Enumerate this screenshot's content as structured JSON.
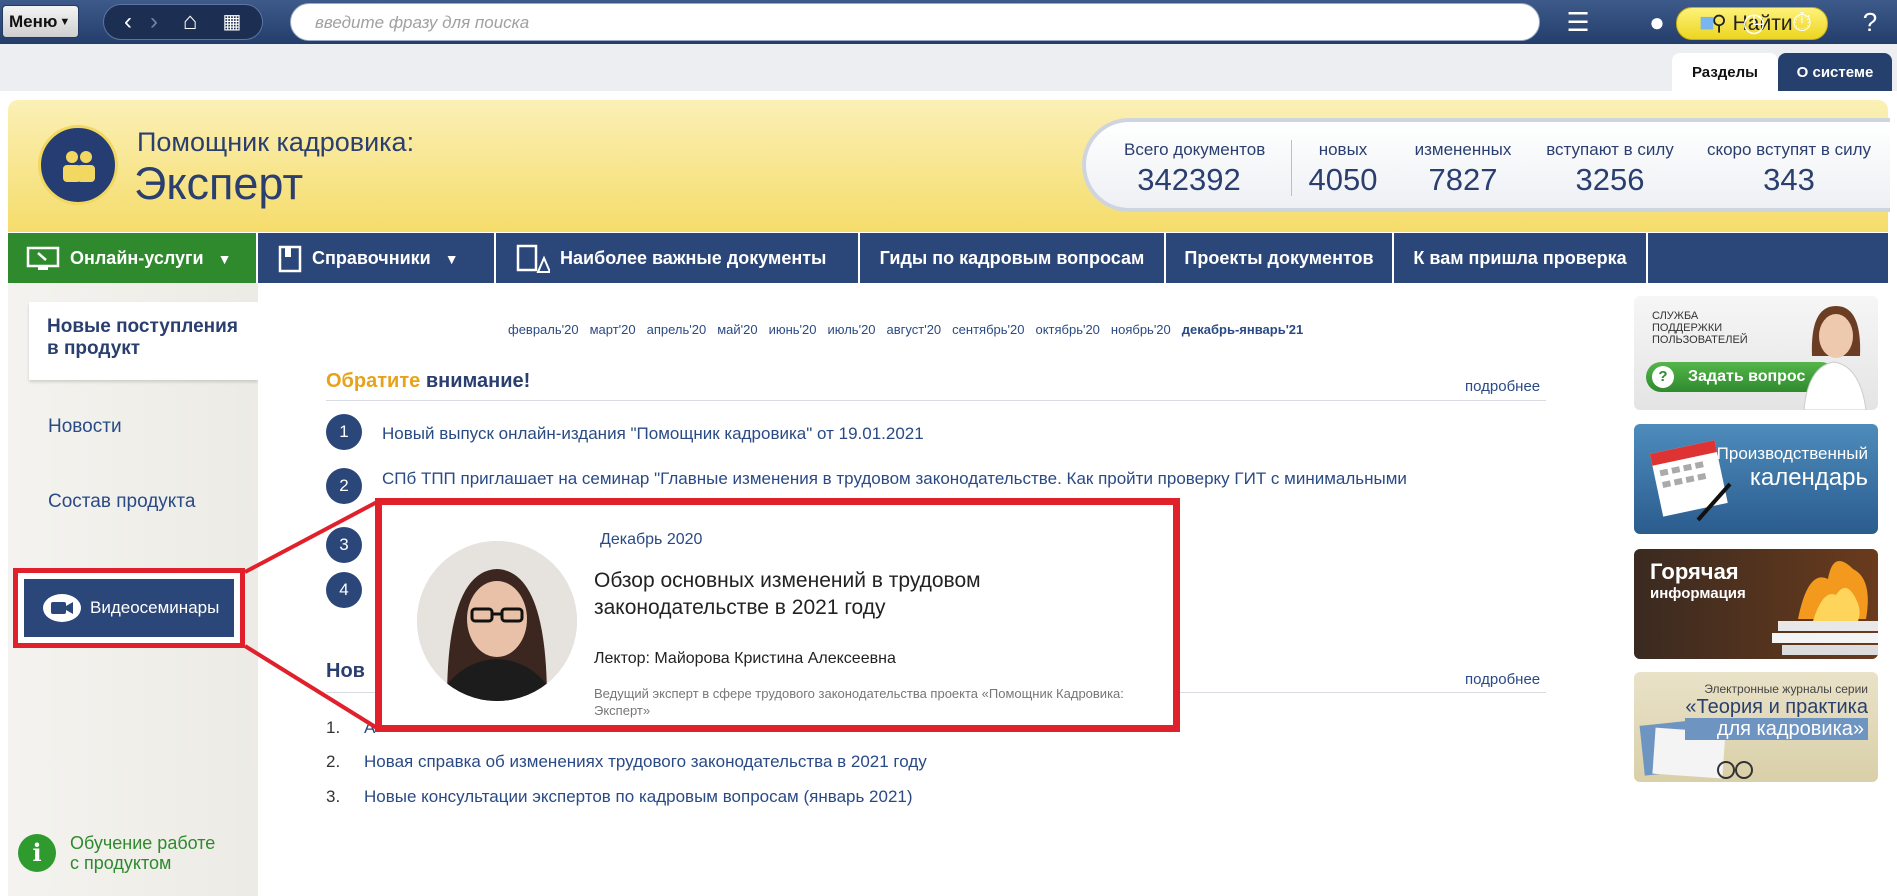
{
  "topbar": {
    "menu_label": "Меню",
    "search_placeholder": "введите фразу для поиска",
    "find_label": "Найти"
  },
  "tabs": [
    {
      "label": "Разделы",
      "active": true
    },
    {
      "label": "О системе",
      "active": false
    }
  ],
  "brand": {
    "line1": "Помощник кадровика:",
    "line2": "Эксперт"
  },
  "stats": [
    {
      "label": "Всего документов",
      "value": "342392"
    },
    {
      "label": "новых",
      "value": "4050"
    },
    {
      "label": "измененных",
      "value": "7827"
    },
    {
      "label": "вступают в силу",
      "value": "3256"
    },
    {
      "label": "скоро вступят в силу",
      "value": "343"
    }
  ],
  "nav": [
    {
      "label": "Онлайн-услуги"
    },
    {
      "label": "Справочники"
    },
    {
      "label": "Наиболее важные документы"
    },
    {
      "label": "Гиды по кадровым вопросам"
    },
    {
      "label": "Проекты документов"
    },
    {
      "label": "К вам пришла проверка"
    }
  ],
  "sidebar": {
    "active_line1": "Новые поступления",
    "active_line2": "в продукт",
    "news": "Новости",
    "composition": "Состав продукта",
    "video": "Видеосеминары",
    "learn_line1": "Обучение работе",
    "learn_line2": "с продуктом"
  },
  "months": [
    "февраль'20",
    "март'20",
    "апрель'20",
    "май'20",
    "июнь'20",
    "июль'20",
    "август'20",
    "сентябрь'20",
    "октябрь'20",
    "ноябрь'20",
    "декабрь-январь'21"
  ],
  "attention": {
    "title_orange": "Обратите",
    "title_blue": "внимание!",
    "more": "подробнее",
    "items": [
      {
        "num": "1",
        "text": "Новый выпуск онлайн-издания \"Помощник кадровика\" от 19.01.2021"
      },
      {
        "num": "2",
        "text": "СПб ТПП приглашает на семинар \"Главные изменения в трудовом законодательстве. Как пройти проверку ГИТ с минимальными"
      },
      {
        "num": "3",
        "text": ""
      },
      {
        "num": "4",
        "text": ""
      }
    ]
  },
  "news": {
    "title": "Нов",
    "more": "подробнее",
    "items": [
      {
        "num": "1.",
        "text": "А"
      },
      {
        "num": "2.",
        "text": "Новая справка об изменениях трудового законодательства в 2021 году"
      },
      {
        "num": "3.",
        "text": "Новые консультации экспертов по кадровым вопросам (январь 2021)"
      }
    ]
  },
  "popup": {
    "date": "Декабрь 2020",
    "title": " Обзор основных изменений в трудовом законодательстве в 2021 году",
    "lecturer": "Лектор: Майорова Кристина Алексеевна",
    "description": "Ведущий эксперт в сфере трудового законодательства проекта «Помощник Кадровика: Эксперт»"
  },
  "banners": {
    "support_text": "СЛУЖБА ПОДДЕРЖКИ ПОЛЬЗОВАТЕЛЕЙ",
    "ask": "Задать вопрос",
    "calendar1": "Производственный",
    "calendar2": "календарь",
    "hot1": "Горячая",
    "hot2": "информация",
    "journal0": "Электронные журналы серии",
    "journal1": "«Теория и практика",
    "journal2": "для кадровика»"
  },
  "colors": {
    "brand_blue": "#2b4678",
    "accent_green": "#2f8a2e",
    "highlight_red": "#e0202a",
    "find_yellow": "#f5e54a"
  }
}
